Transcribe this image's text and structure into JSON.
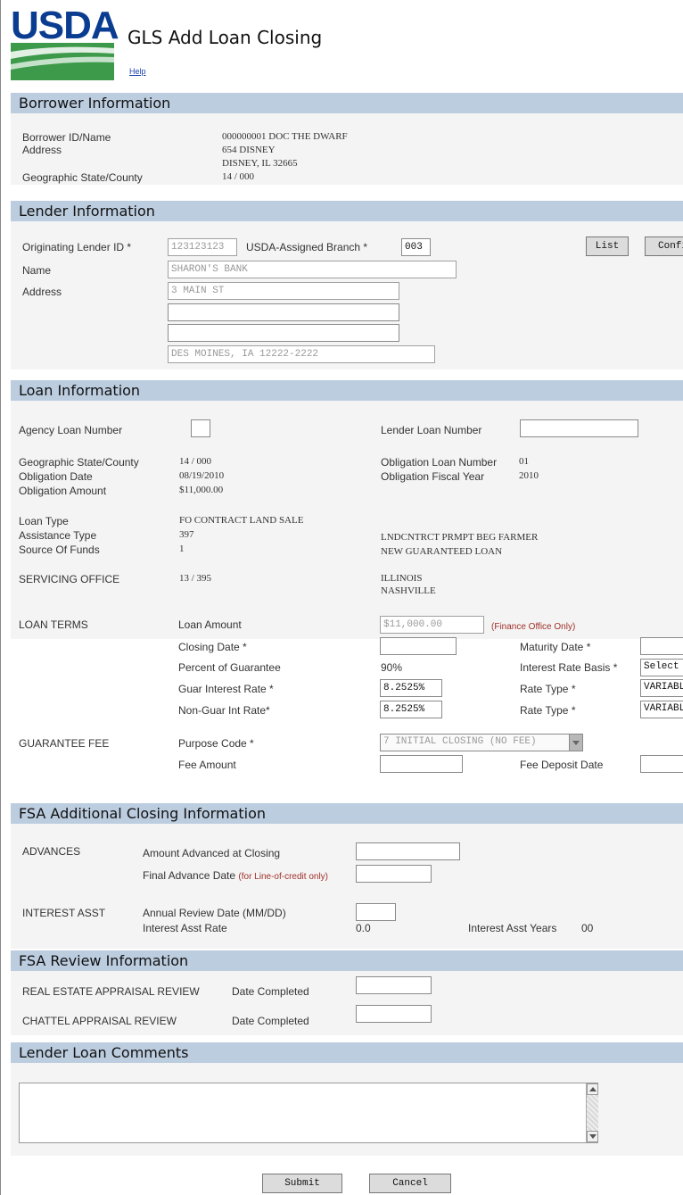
{
  "header": {
    "logo_text": "USDA",
    "title": "GLS Add Loan Closing",
    "help_link": "Help"
  },
  "sections": {
    "borrower": "Borrower Information",
    "lender": "Lender Information",
    "loan": "Loan Information",
    "fsa_closing": "FSA Additional Closing Information",
    "fsa_review": "FSA Review Information",
    "comments": "Lender Loan Comments"
  },
  "borrower": {
    "id_name_label": "Borrower ID/Name",
    "id_name_value": "000000001  DOC THE DWARF",
    "address_label": "Address",
    "address_line1": "654 DISNEY",
    "address_line2": "DISNEY, IL 32665",
    "geo_label": "Geographic State/County",
    "geo_value": "14 / 000"
  },
  "lender": {
    "orig_id_label": "Originating Lender ID *",
    "orig_id_value": "123123123",
    "branch_label": "USDA-Assigned Branch *",
    "branch_value": "003",
    "list_button": "List",
    "confirm_button": "Confirm",
    "name_label": "Name",
    "name_value": "SHARON'S BANK",
    "address_label": "Address",
    "address_line1": "3 MAIN ST",
    "address_line2": "",
    "address_line3": "",
    "address_city": "DES MOINES, IA 12222-2222"
  },
  "loan": {
    "agency_loan_label": "Agency Loan Number",
    "agency_loan_value": "",
    "lender_loan_label": "Lender Loan Number",
    "lender_loan_value": "",
    "geo_label": "Geographic State/County",
    "geo_value": "14 / 000",
    "obligation_date_label": "Obligation Date",
    "obligation_date_value": "08/19/2010",
    "obligation_amount_label": "Obligation Amount",
    "obligation_amount_value": "$11,000.00",
    "obligation_loan_number_label": "Obligation Loan Number",
    "obligation_loan_number_value": "01",
    "obligation_fiscal_year_label": "Obligation Fiscal Year",
    "obligation_fiscal_year_value": "2010",
    "loan_type_label": "Loan Type",
    "loan_type_value": "FO  CONTRACT LAND SALE",
    "assistance_type_label": "Assistance Type",
    "assistance_type_code": "397",
    "assistance_type_desc": "LNDCNTRCT PRMPT BEG FARMER",
    "source_funds_label": "Source Of Funds",
    "source_funds_code": "1",
    "source_funds_desc": "NEW GUARANTEED LOAN",
    "servicing_office_label": "SERVICING OFFICE",
    "servicing_office_code": "13 / 395",
    "servicing_office_state": "ILLINOIS",
    "servicing_office_city": "NASHVILLE",
    "terms_label": "LOAN TERMS",
    "loan_amount_label": "Loan Amount",
    "loan_amount_value": "$11,000.00",
    "finance_only_note": "(Finance Office Only)",
    "closing_date_label": "Closing Date *",
    "closing_date_value": "",
    "maturity_date_label": "Maturity Date *",
    "maturity_date_value": "",
    "percent_guarantee_label": "Percent of Guarantee",
    "percent_guarantee_value": "90%",
    "interest_basis_label": "Interest Rate Basis *",
    "interest_basis_value": "Select",
    "guar_rate_label": "Guar Interest Rate *",
    "guar_rate_value": "8.2525%",
    "rate_type_label": "Rate Type *",
    "rate_type_value_1": "VARIABLE",
    "nonguar_rate_label": "Non-Guar Int Rate*",
    "nonguar_rate_value": "8.2525%",
    "rate_type_label_2": "Rate Type *",
    "rate_type_value_2": "VARIABLE",
    "fee_label": "GUARANTEE FEE",
    "purpose_code_label": "Purpose Code *",
    "purpose_code_value": "7 INITIAL CLOSING (NO FEE)",
    "fee_amount_label": "Fee Amount",
    "fee_amount_value": "",
    "fee_deposit_label": "Fee Deposit Date",
    "fee_deposit_value": ""
  },
  "fsa_closing": {
    "advances_label": "ADVANCES",
    "amount_advanced_label": "Amount Advanced at Closing",
    "amount_advanced_value": "",
    "final_advance_label": "Final Advance Date",
    "final_advance_note": "(for Line-of-credit only)",
    "final_advance_value": "",
    "interest_asst_label": "INTEREST ASST",
    "annual_review_label": "Annual Review Date (MM/DD)",
    "annual_review_value": "",
    "interest_asst_rate_label": "Interest Asst Rate",
    "interest_asst_rate_value": "0.0",
    "interest_asst_years_label": "Interest Asst Years",
    "interest_asst_years_value": "00"
  },
  "fsa_review": {
    "real_estate_label": "REAL ESTATE APPRAISAL REVIEW",
    "real_estate_date_label": "Date Completed",
    "real_estate_date_value": "",
    "chattel_label": "CHATTEL APPRAISAL REVIEW",
    "chattel_date_label": "Date Completed",
    "chattel_date_value": ""
  },
  "comments": {
    "value": ""
  },
  "footer": {
    "submit_button": "Submit",
    "cancel_button": "Cancel"
  },
  "colors": {
    "section_header_bg": "#bccde0",
    "logo_blue": "#0a3d91",
    "logo_green": "#2e8b3a"
  }
}
